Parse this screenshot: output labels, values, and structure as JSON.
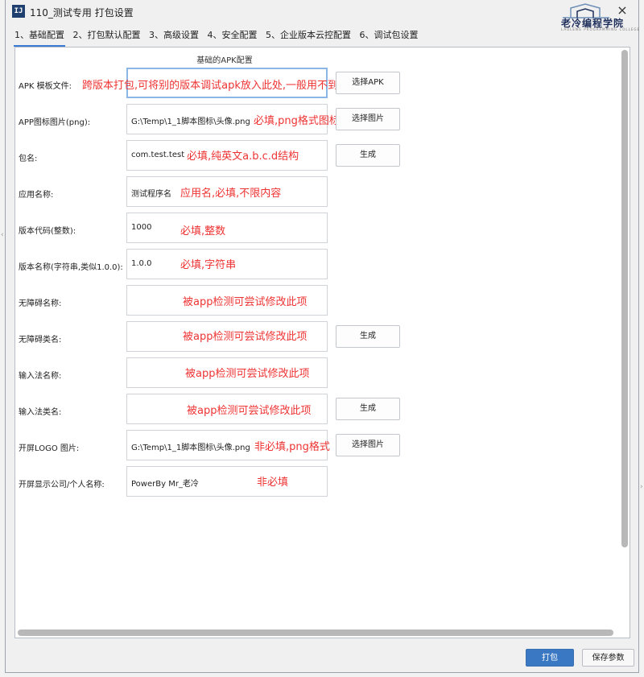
{
  "window": {
    "icon": "IJ",
    "title": "110_测试专用 打包设置",
    "close": "×",
    "logo_text": "老冷编程学院",
    "logo_sub": "LAOLENG PROGRAMMING COLLEGE"
  },
  "tabs": [
    {
      "label": "1、基础配置"
    },
    {
      "label": "2、打包默认配置"
    },
    {
      "label": "3、高级设置"
    },
    {
      "label": "4、安全配置"
    },
    {
      "label": "5、企业版本云控配置"
    },
    {
      "label": "6、调试包设置"
    }
  ],
  "section_title": "基础的APK配置",
  "rows": [
    {
      "label": "APK 模板文件:",
      "value": "",
      "hint": "跨版本打包,可将别的版本调试apk放入此处,一般用不到",
      "button": "选择APK"
    },
    {
      "label": "APP图标图片(png):",
      "value": "G:\\Temp\\1_1脚本图标\\头像.png",
      "hint": "必填,png格式图标",
      "button": "选择图片"
    },
    {
      "label": "包名:",
      "value": "com.test.test",
      "hint": "必填,纯英文a.b.c.d结构",
      "button": "生成"
    },
    {
      "label": "应用名称:",
      "value": "测试程序名",
      "hint": "应用名,必填,不限内容",
      "button": ""
    },
    {
      "label": "版本代码(整数):",
      "value": "1000",
      "hint": "必填,整数",
      "button": ""
    },
    {
      "label": "版本名称(字符串,类似1.0.0):",
      "value": "1.0.0",
      "hint": "必填,字符串",
      "button": ""
    },
    {
      "label": "无障碍名称:",
      "value": "",
      "hint": "被app检测可尝试修改此项",
      "button": ""
    },
    {
      "label": "无障碍类名:",
      "value": "",
      "hint": "被app检测可尝试修改此项",
      "button": "生成"
    },
    {
      "label": "输入法名称:",
      "value": "",
      "hint": "被app检测可尝试修改此项",
      "button": ""
    },
    {
      "label": "输入法类名:",
      "value": "",
      "hint": "被app检测可尝试修改此项",
      "button": "生成"
    },
    {
      "label": "开屏LOGO 图片:",
      "value": "G:\\Temp\\1_1脚本图标\\头像.png",
      "hint": "非必填,png格式",
      "button": "选择图片"
    },
    {
      "label": "开屏显示公司/个人名称:",
      "value": "PowerBy Mr_老冷",
      "hint": "非必填",
      "button": ""
    }
  ],
  "footer": {
    "pack_label": "打包",
    "save_label": "保存参数"
  },
  "colors": {
    "hint": "#ee3333",
    "primary_button": "#3a78c3",
    "tab_underline": "#3b7bd3"
  }
}
